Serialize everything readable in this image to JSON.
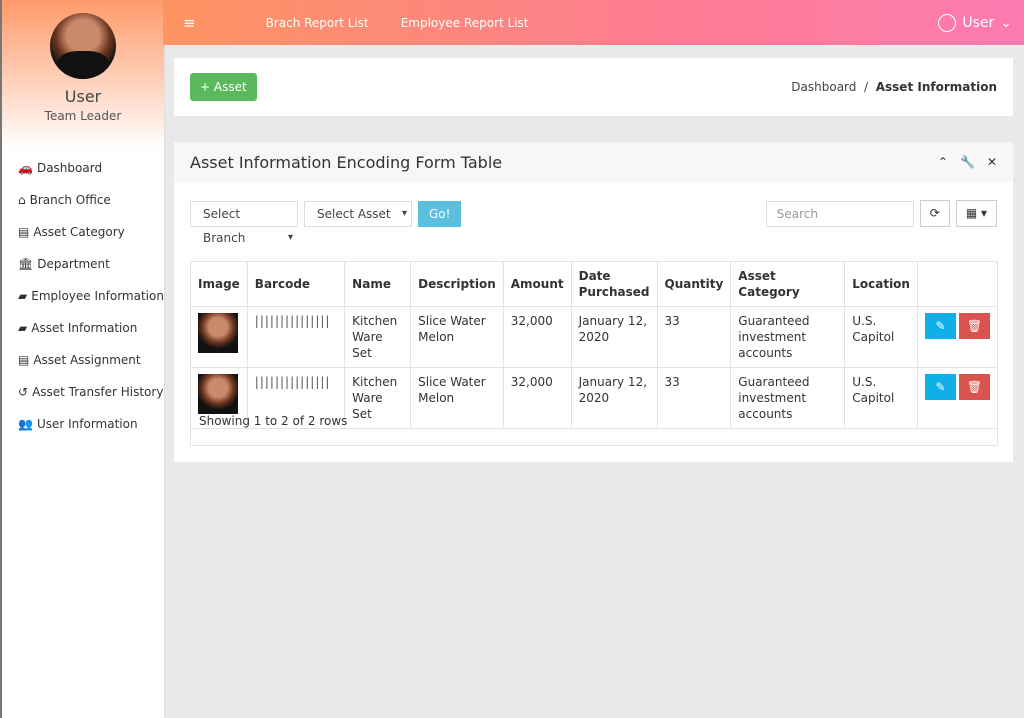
{
  "sidebar": {
    "user": "User",
    "role": "Team Leader",
    "items": [
      {
        "label": "Dashboard",
        "icon": "🚗"
      },
      {
        "label": "Branch Office",
        "icon": "⌂"
      },
      {
        "label": "Asset Category",
        "icon": "▤"
      },
      {
        "label": "Department",
        "icon": "🏛"
      },
      {
        "label": "Employee Information",
        "icon": "▰"
      },
      {
        "label": "Asset Information",
        "icon": "▰"
      },
      {
        "label": "Asset Assignment",
        "icon": "▤"
      },
      {
        "label": "Asset Transfer History",
        "icon": "↺"
      },
      {
        "label": "User Information",
        "icon": "👥"
      }
    ]
  },
  "topbar": {
    "menu_icon": "≡",
    "links": [
      "Brach Report List",
      "Employee Report List"
    ],
    "user": "User",
    "caret": "⌄"
  },
  "toolbar": {
    "add_label": "+ Asset",
    "breadcrumb": [
      "Dashboard",
      "Asset Information"
    ],
    "sep": "/"
  },
  "panel": {
    "title": "Asset Information Encoding Form Table",
    "tools": [
      "⌃",
      "🔧",
      "✕"
    ],
    "filters": {
      "branch": "Select Branch",
      "asset": "Select Asset",
      "go": "Go!",
      "search_placeholder": "Search",
      "refresh": "⟳",
      "columns": "▦ ▾"
    },
    "columns": [
      "Image",
      "Barcode",
      "Name",
      "Description",
      "Amount",
      "Date Purchased",
      "Quantity",
      "Asset Category",
      "Location",
      ""
    ],
    "rows": [
      {
        "barcode": "|||||||||||||||",
        "name": "Kitchen Ware Set",
        "description": "Slice Water Melon",
        "amount": "32,000",
        "date": "January 12, 2020",
        "quantity": "33",
        "category": "Guaranteed investment accounts",
        "location": "U.S. Capitol"
      },
      {
        "barcode": "|||||||||||||||",
        "name": "Kitchen Ware Set",
        "description": "Slice Water Melon",
        "amount": "32,000",
        "date": "January 12, 2020",
        "quantity": "33",
        "category": "Guaranteed investment accounts",
        "location": "U.S. Capitol"
      }
    ],
    "edit_icon": "✎",
    "delete_icon": "🗑",
    "footer": "Showing 1 to 2 of 2 rows"
  }
}
